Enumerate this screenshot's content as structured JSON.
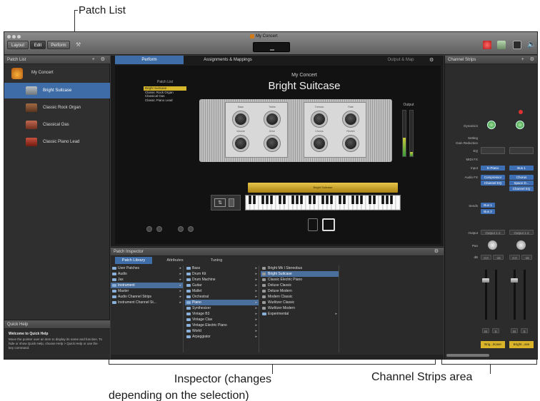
{
  "annotations": {
    "patch_list": "Patch List",
    "inspector_line1": "Inspector (changes",
    "inspector_line2": "depending on the selection)",
    "channel_strips": "Channel Strips area"
  },
  "window": {
    "title": "My Concert",
    "modes": [
      "Layout",
      "Edit",
      "Perform"
    ],
    "active_mode": "Edit"
  },
  "patch_list": {
    "header": "Patch List",
    "concert": "My Concert",
    "items": [
      {
        "label": "Bright Suitcase",
        "selected": true,
        "color": "#9aa2a8"
      },
      {
        "label": "Classic Rock Organ",
        "selected": false,
        "color": "#8a5a3a"
      },
      {
        "label": "Classical Oas",
        "selected": false,
        "color": "#a05040"
      },
      {
        "label": "Classic Piano Lead",
        "selected": false,
        "color": "#b04030"
      }
    ]
  },
  "quick_help": {
    "header": "Quick Help",
    "title": "Welcome to Quick Help",
    "body": "Move the pointer over an item to display its name and function. To hide or show Quick Help, choose Help > Quick Help or use the key command."
  },
  "center": {
    "tabs": [
      "Perform",
      "Assignments & Mappings"
    ],
    "active_tab": "Perform",
    "right_label": "Output & Map",
    "concert_patch_list": {
      "title": "Patch List",
      "items": [
        "Bright Suitcase",
        "Classic Rock Organ",
        "Classical Oas",
        "Classic Piano Lead"
      ]
    },
    "concert_name": "My Concert",
    "patch_name": "Bright Suitcase",
    "output_label": "Output",
    "instrument_label": "Bright Suitcase"
  },
  "inspector": {
    "header": "Patch Inspector",
    "tabs": [
      "Patch Library",
      "Attributes",
      "Tuning"
    ],
    "active_tab": "Patch Library",
    "col1": [
      "User Patches",
      "Audio",
      "Jax",
      "Instrument",
      "Master",
      "Audio Channel Strips",
      "Instrument Channel St..."
    ],
    "col1_selected": "Instrument",
    "col2": [
      "Bass",
      "Drum Kit",
      "Drum Machine",
      "Guitar",
      "Mallet",
      "Orchestral",
      "Piano",
      "Synthesizer",
      "Vintage B3",
      "Vintage Clav",
      "Vintage Electric Piano",
      "World",
      "Arpeggiator"
    ],
    "col3": [
      "Bright Mk I Stereobus",
      "Bright Suitcase",
      "Classic Electric Piano",
      "Deluxe Classic",
      "Deluxe Modern",
      "Modern Classic",
      "Wurlitzer Classic",
      "Wurlitzer Modern",
      "Experimental"
    ],
    "col3_selected": "Bright Suitcase"
  },
  "channel_strips": {
    "header": "Channel Strips",
    "labels": [
      "Dynamics",
      "Setting",
      "Gain Reduction",
      "EQ",
      "MIDI FX",
      "Input",
      "Audio FX",
      "Sends",
      "Output",
      "Pan",
      "dB"
    ],
    "strip1": {
      "input": "E-Piano",
      "fx1": "Compressor",
      "fx2": "Channel EQ",
      "send1": "Bus 1",
      "send2": "Bus 2",
      "output": "Output 1-2",
      "db1": "0.0",
      "db2": "-15",
      "name": "Brig...itcase"
    },
    "strip2": {
      "input": "Bus 1",
      "fx1": "Chorus",
      "fx2": "Space D...",
      "fx3": "Channel EQ",
      "output": "Output 1-2",
      "db1": "0.0",
      "db2": "-15",
      "name": "Bright...ase"
    },
    "bottom_labels": [
      "M",
      "S",
      "M",
      "S"
    ]
  }
}
